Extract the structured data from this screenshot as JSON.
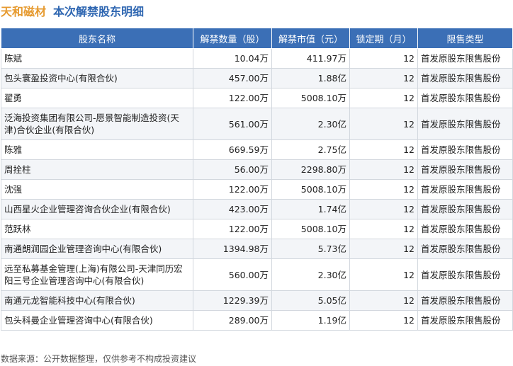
{
  "header": {
    "company": "天和磁材",
    "title": "本次解禁股东明细"
  },
  "table": {
    "columns": [
      "股东名称",
      "解禁数量（股）",
      "解禁市值（元）",
      "锁定期（月）",
      "限售类型"
    ],
    "rows": [
      {
        "name": "陈斌",
        "qty": "10.04万",
        "value": "411.97万",
        "lock": "12",
        "type": "首发原股东限售股份"
      },
      {
        "name": "包头寰盈投资中心(有限合伙)",
        "qty": "457.00万",
        "value": "1.88亿",
        "lock": "12",
        "type": "首发原股东限售股份"
      },
      {
        "name": "翟勇",
        "qty": "122.00万",
        "value": "5008.10万",
        "lock": "12",
        "type": "首发原股东限售股份"
      },
      {
        "name": "泛海投资集团有限公司-愿景智能制造投资(天津)合伙企业(有限合伙)",
        "qty": "561.00万",
        "value": "2.30亿",
        "lock": "12",
        "type": "首发原股东限售股份"
      },
      {
        "name": "陈雅",
        "qty": "669.59万",
        "value": "2.75亿",
        "lock": "12",
        "type": "首发原股东限售股份"
      },
      {
        "name": "周拴柱",
        "qty": "56.00万",
        "value": "2298.80万",
        "lock": "12",
        "type": "首发原股东限售股份"
      },
      {
        "name": "沈强",
        "qty": "122.00万",
        "value": "5008.10万",
        "lock": "12",
        "type": "首发原股东限售股份"
      },
      {
        "name": "山西星火企业管理咨询合伙企业(有限合伙)",
        "qty": "423.00万",
        "value": "1.74亿",
        "lock": "12",
        "type": "首发原股东限售股份"
      },
      {
        "name": "范跃林",
        "qty": "122.00万",
        "value": "5008.10万",
        "lock": "12",
        "type": "首发原股东限售股份"
      },
      {
        "name": "南通朗润园企业管理咨询中心(有限合伙)",
        "qty": "1394.98万",
        "value": "5.73亿",
        "lock": "12",
        "type": "首发原股东限售股份"
      },
      {
        "name": "远至私募基金管理(上海)有限公司-天津同历宏阳三号企业管理咨询中心(有限合伙)",
        "qty": "560.00万",
        "value": "2.30亿",
        "lock": "12",
        "type": "首发原股东限售股份"
      },
      {
        "name": "南通元龙智能科技中心(有限合伙)",
        "qty": "1229.39万",
        "value": "5.05亿",
        "lock": "12",
        "type": "首发原股东限售股份"
      },
      {
        "name": "包头科曼企业管理咨询中心(有限合伙)",
        "qty": "289.00万",
        "value": "1.19亿",
        "lock": "12",
        "type": "首发原股东限售股份"
      }
    ]
  },
  "footer": {
    "source": "数据来源：公开数据整理，仅供参考不构成投资建议"
  }
}
